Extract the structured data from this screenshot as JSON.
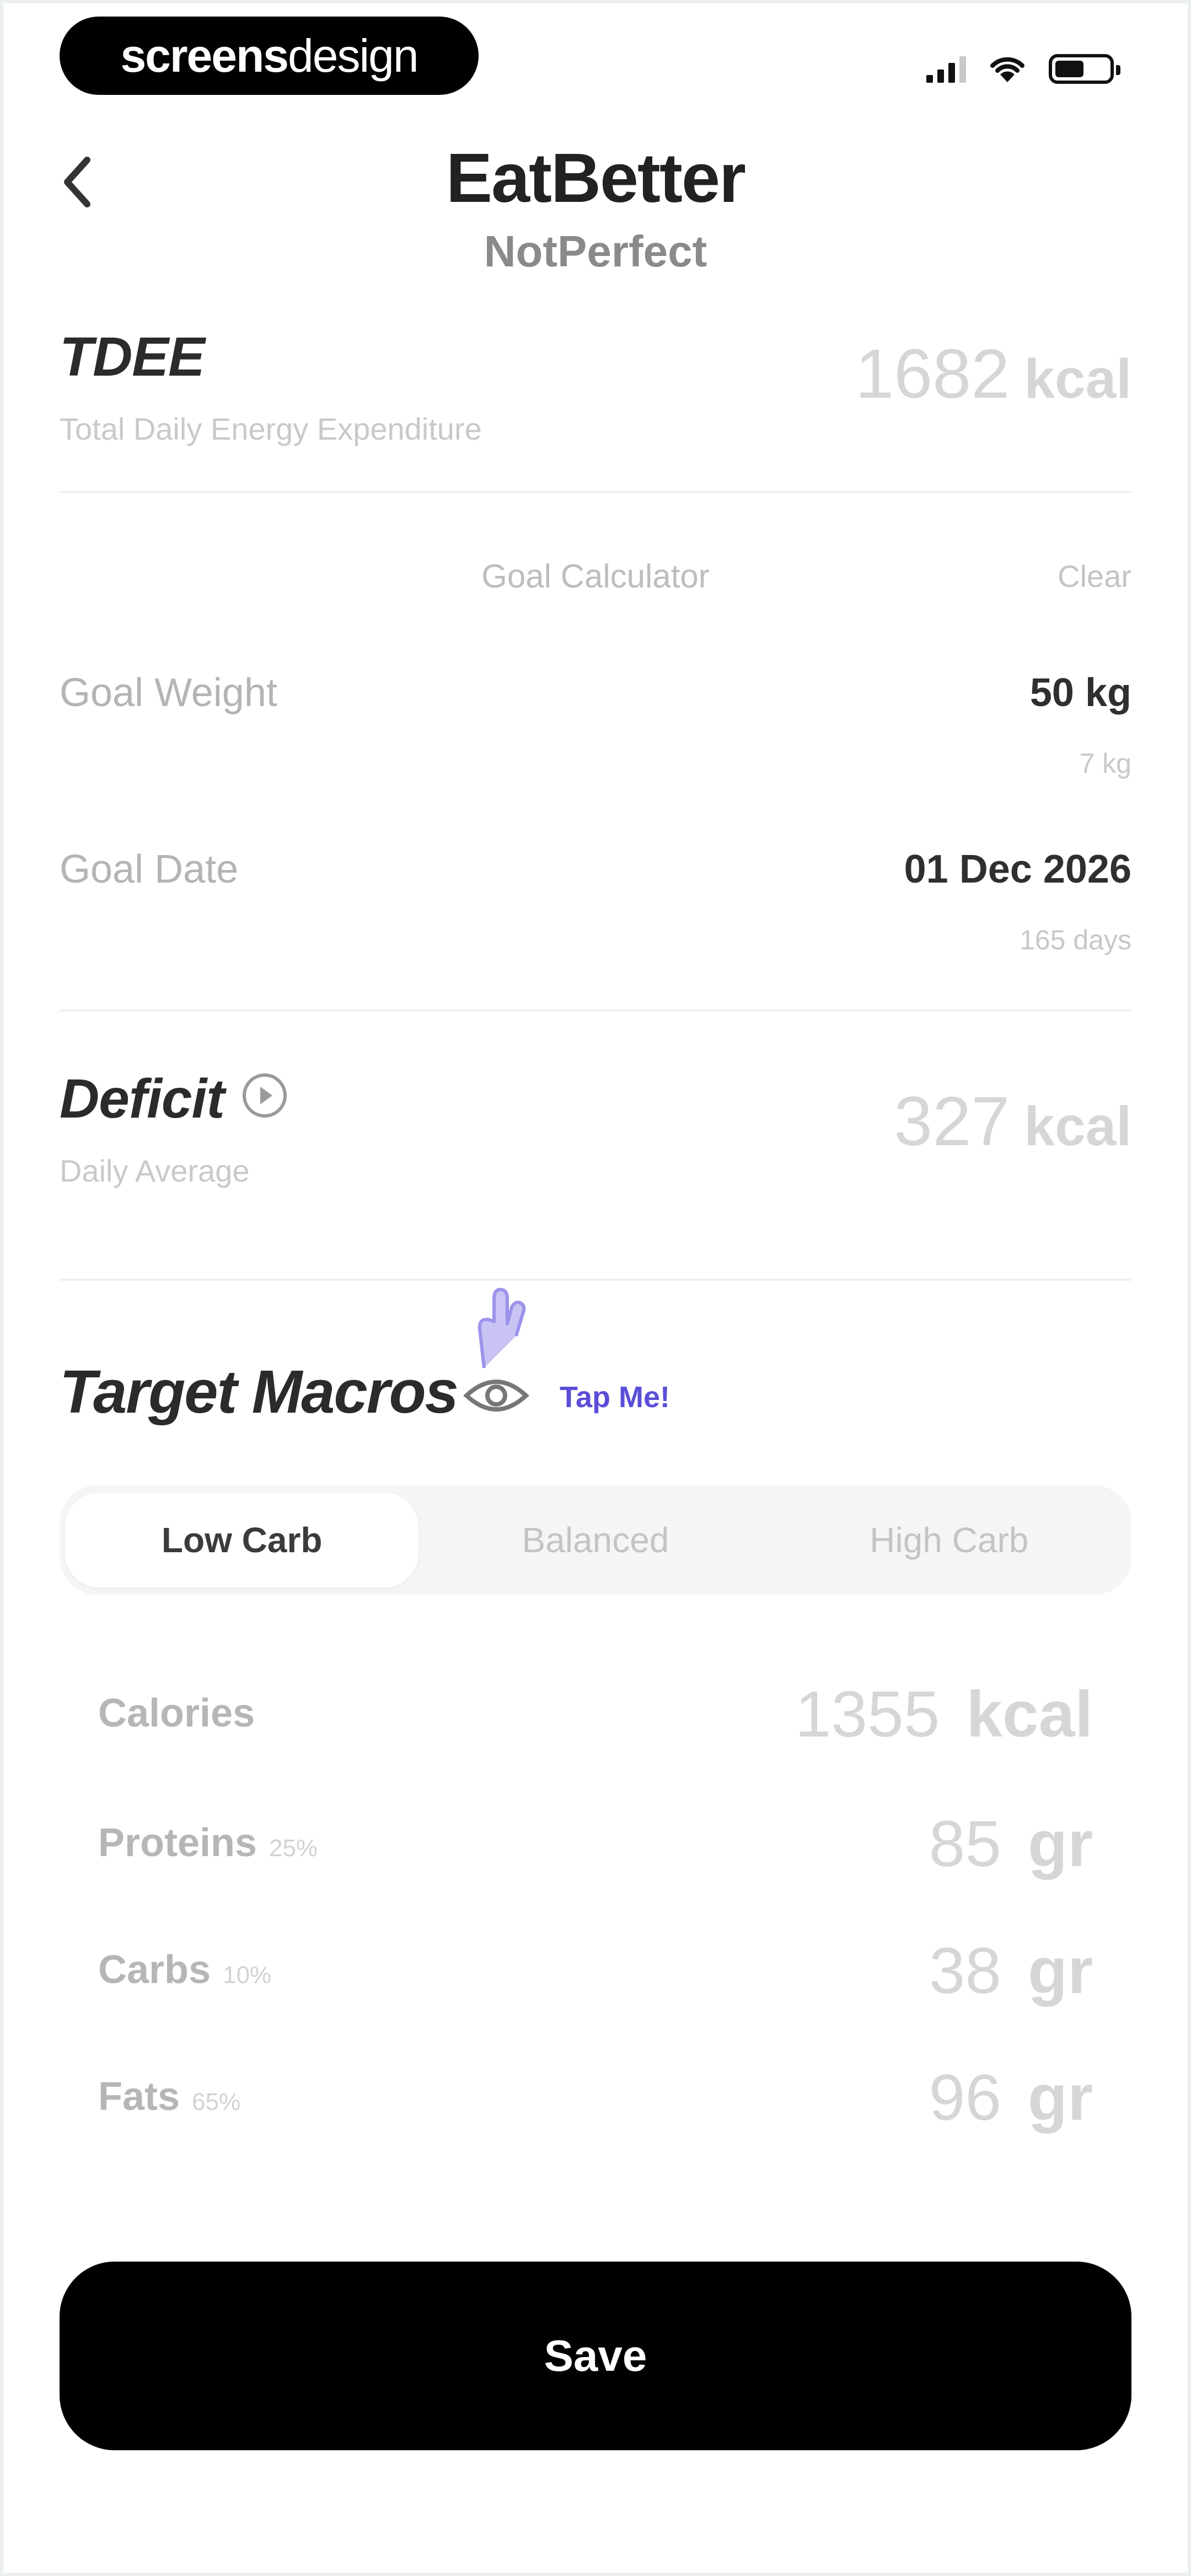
{
  "status_bar": {
    "brand_bold": "screens",
    "brand_thin": "design"
  },
  "header": {
    "title": "EatBetter",
    "subtitle": "NotPerfect"
  },
  "tdee": {
    "label": "TDEE",
    "caption": "Total Daily Energy Expenditure",
    "value": "1682",
    "unit": "kcal"
  },
  "goal_calculator": {
    "title": "Goal Calculator",
    "clear_label": "Clear",
    "goal_weight": {
      "label": "Goal Weight",
      "value": "50 kg",
      "sub": "7 kg"
    },
    "goal_date": {
      "label": "Goal Date",
      "value": "01 Dec 2026",
      "sub": "165 days"
    }
  },
  "deficit": {
    "label": "Deficit",
    "caption": "Daily Average",
    "value": "327",
    "unit": "kcal"
  },
  "macros": {
    "title": "Target Macros",
    "tap_hint": "Tap Me!",
    "segments": [
      "Low Carb",
      "Balanced",
      "High Carb"
    ],
    "selected_segment": "Low Carb",
    "rows": [
      {
        "label": "Calories",
        "pct": "",
        "value": "1355",
        "unit": "kcal"
      },
      {
        "label": "Proteins",
        "pct": "25%",
        "value": "85",
        "unit": "gr"
      },
      {
        "label": "Carbs",
        "pct": "10%",
        "value": "38",
        "unit": "gr"
      },
      {
        "label": "Fats",
        "pct": "65%",
        "value": "96",
        "unit": "gr"
      }
    ]
  },
  "save_label": "Save",
  "icons": {
    "back": "chevron-left-icon",
    "info": "info-play-icon",
    "eye": "eye-icon",
    "pointer": "tap-pointer-icon"
  },
  "colors": {
    "accent": "#5a4ed8",
    "button": "#000000"
  }
}
